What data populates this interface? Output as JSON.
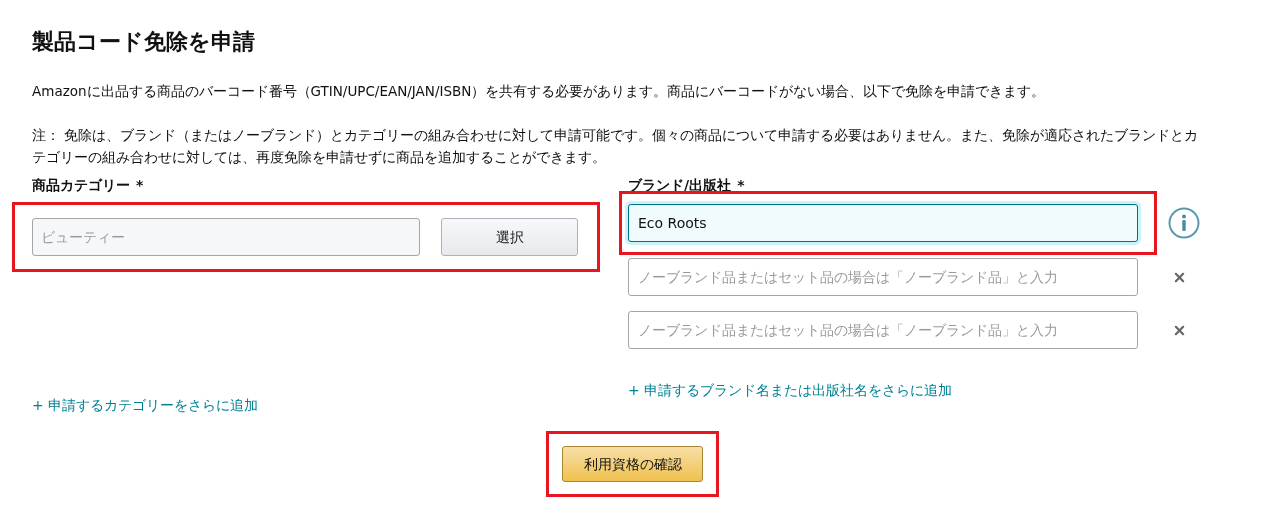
{
  "title": "製品コード免除を申請",
  "intro": "Amazonに出品する商品のバーコード番号（GTIN/UPC/EAN/JAN/ISBN）を共有する必要があります。商品にバーコードがない場合、以下で免除を申請できます。",
  "note": "注： 免除は、ブランド（またはノーブランド）とカテゴリーの組み合わせに対して申請可能です。個々の商品について申請する必要はありません。また、免除が適応されたブランドとカテゴリーの組み合わせに対しては、再度免除を申請せずに商品を追加することができます。",
  "category": {
    "label": "商品カテゴリー",
    "required_mark": "*",
    "placeholder": "ビューティー",
    "button": "選択",
    "highlighted": true,
    "add_link": "+ 申請するカテゴリーをさらに追加"
  },
  "brand": {
    "label": "ブランド/出版社",
    "required_mark": "*",
    "add_link": "+ 申請するブランド名または出版社名をさらに追加",
    "fields": [
      {
        "kind": "info",
        "value": "Eco Roots",
        "focused": true,
        "highlighted": true
      },
      {
        "kind": "removable",
        "placeholder": "ノーブランド品またはセット品の場合は「ノーブランド品」と入力",
        "focused": false,
        "highlighted": false
      },
      {
        "kind": "removable",
        "placeholder": "ノーブランド品またはセット品の場合は「ノーブランド品」と入力",
        "focused": false,
        "highlighted": false
      }
    ]
  },
  "submit": {
    "label": "利用資格の確認",
    "highlighted": true
  }
}
